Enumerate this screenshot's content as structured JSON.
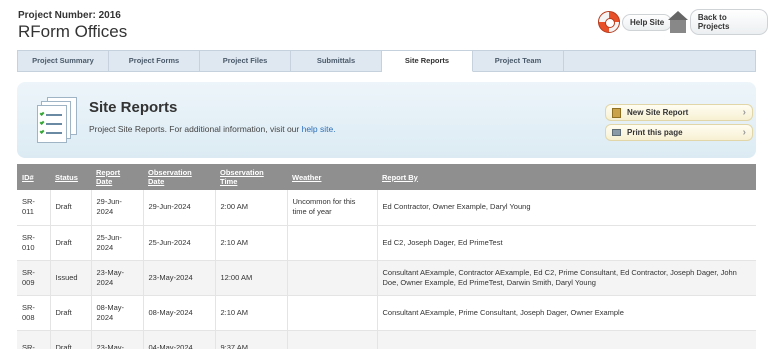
{
  "header": {
    "project_number": "Project Number: 2016",
    "project_name": "RForm Offices",
    "help_label": "Help Site",
    "back_label": "Back to Projects"
  },
  "tabs": [
    {
      "label": "Project Summary",
      "active": false
    },
    {
      "label": "Project Forms",
      "active": false
    },
    {
      "label": "Project Files",
      "active": false
    },
    {
      "label": "Submittals",
      "active": false
    },
    {
      "label": "Site Reports",
      "active": true
    },
    {
      "label": "Project Team",
      "active": false
    }
  ],
  "banner": {
    "title": "Site Reports",
    "desc_prefix": "Project Site Reports. For additional information, visit our ",
    "desc_link": "help site.",
    "new_report_label": "New Site Report",
    "print_label": "Print this page"
  },
  "table": {
    "columns": [
      "ID#",
      "Status",
      "Report Date",
      "Observation Date",
      "Observation Time",
      "Weather",
      "Report By"
    ],
    "rows": [
      {
        "id": "SR-011",
        "status": "Draft",
        "report_date": "29-Jun-2024",
        "obs_date": "29-Jun-2024",
        "obs_time": "2:00 AM",
        "weather": "Uncommon for this time of year",
        "report_by": "Ed Contractor, Owner Example, Daryl Young"
      },
      {
        "id": "SR-010",
        "status": "Draft",
        "report_date": "25-Jun-2024",
        "obs_date": "25-Jun-2024",
        "obs_time": "2:10 AM",
        "weather": "",
        "report_by": "Ed C2, Joseph Dager, Ed PrimeTest"
      },
      {
        "id": "SR-009",
        "status": "Issued",
        "report_date": "23-May-2024",
        "obs_date": "23-May-2024",
        "obs_time": "12:00 AM",
        "weather": "",
        "report_by": "Consultant AExample, Contractor AExample, Ed C2, Prime Consultant, Ed Contractor, Joseph Dager, John Doe, Owner Example, Ed PrimeTest, Darwin Smith, Daryl Young"
      },
      {
        "id": "SR-008",
        "status": "Draft",
        "report_date": "08-May-2024",
        "obs_date": "08-May-2024",
        "obs_time": "2:10 AM",
        "weather": "",
        "report_by": "Consultant AExample, Prime Consultant, Joseph Dager, Owner Example"
      },
      {
        "id": "SR-",
        "status": "Draft",
        "report_date": "23-May-",
        "obs_date": "04-May-2024",
        "obs_time": "9:37 AM",
        "weather": "",
        "report_by": ""
      }
    ]
  }
}
